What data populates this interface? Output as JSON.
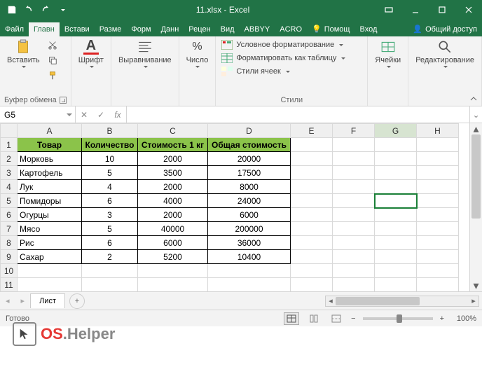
{
  "title": "11.xlsx - Excel",
  "tabs": {
    "file": "Файл",
    "home": "Главн",
    "insert": "Встави",
    "layout": "Разме",
    "formulas": "Форм",
    "data": "Данн",
    "review": "Рецен",
    "view": "Вид",
    "abbyy": "ABBYY",
    "acro": "ACRO",
    "help": "Помощ",
    "login": "Вход",
    "share": "Общий доступ"
  },
  "ribbon": {
    "paste": "Вставить",
    "clipboard_label": "Буфер обмена",
    "font_label": "Шрифт",
    "align_label": "Выравнивание",
    "number_label": "Число",
    "styles_label": "Стили",
    "cells_label": "Ячейки",
    "editing_label": "Редактирование",
    "cond_format": "Условное форматирование",
    "as_table": "Форматировать как таблицу",
    "cell_styles": "Стили ячеек"
  },
  "namebox": "G5",
  "fx": "fx",
  "columns": [
    "A",
    "B",
    "C",
    "D",
    "E",
    "F",
    "G",
    "H"
  ],
  "headers": {
    "product": "Товар",
    "qty": "Количество",
    "price": "Стоимость 1 кг",
    "total": "Общая стоимость"
  },
  "data_rows": [
    {
      "p": "Морковь",
      "q": "10",
      "c": "2000",
      "t": "20000"
    },
    {
      "p": "Картофель",
      "q": "5",
      "c": "3500",
      "t": "17500"
    },
    {
      "p": "Лук",
      "q": "4",
      "c": "2000",
      "t": "8000"
    },
    {
      "p": "Помидоры",
      "q": "6",
      "c": "4000",
      "t": "24000"
    },
    {
      "p": "Огурцы",
      "q": "3",
      "c": "2000",
      "t": "6000"
    },
    {
      "p": "Мясо",
      "q": "5",
      "c": "40000",
      "t": "200000"
    },
    {
      "p": "Рис",
      "q": "6",
      "c": "6000",
      "t": "36000"
    },
    {
      "p": "Сахар",
      "q": "2",
      "c": "5200",
      "t": "10400"
    }
  ],
  "sheet_tab": "Лист",
  "status": "Готово",
  "zoom": "100%",
  "watermark": {
    "a": "OS",
    "b": ".Helper"
  }
}
